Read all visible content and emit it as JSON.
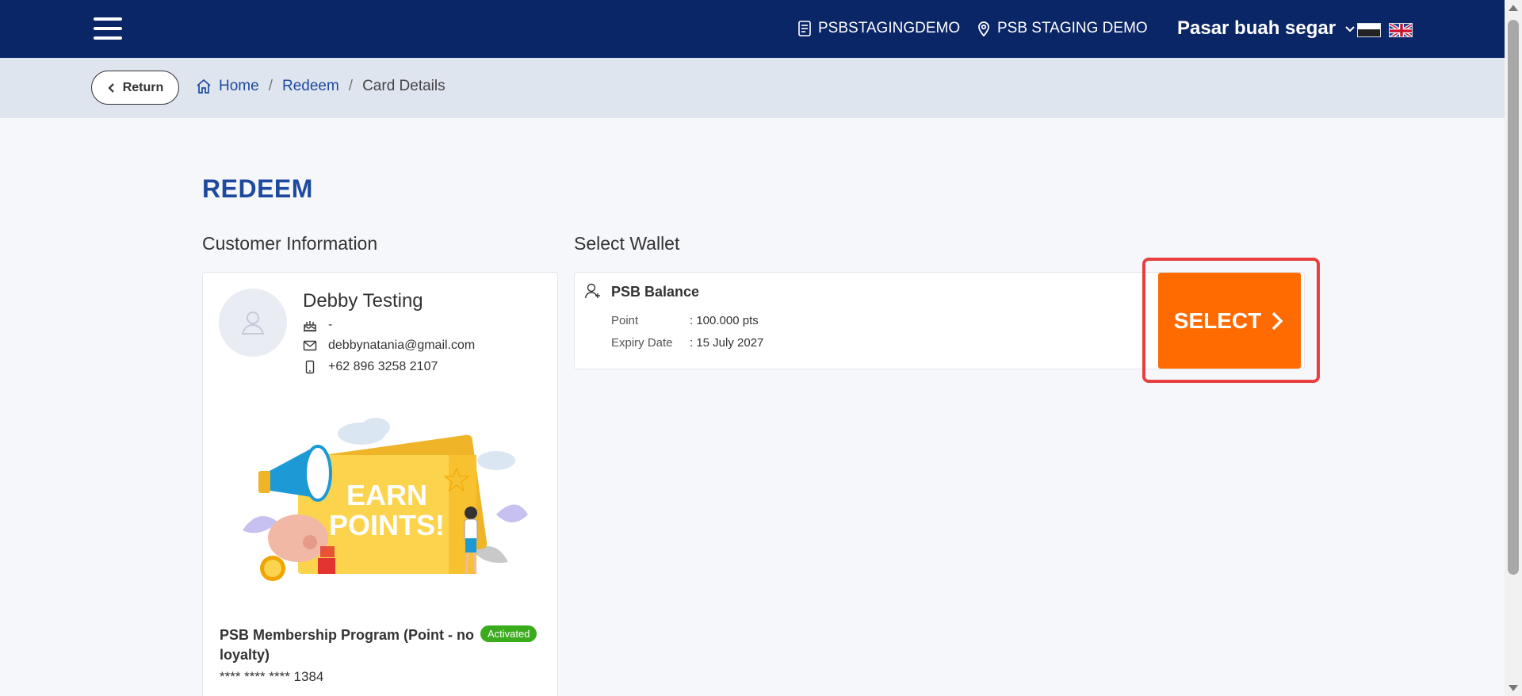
{
  "header": {
    "store_code": "PSBSTAGINGDEMO",
    "location": "PSB STAGING DEMO",
    "user": "Pasar buah segar",
    "icons": [
      "menu-icon",
      "receipt-icon",
      "location-pin-icon",
      "chevron-down-icon",
      "flag-id-icon",
      "flag-uk-icon"
    ]
  },
  "breadcrumb": {
    "return_label": "Return",
    "items": [
      "Home",
      "Redeem",
      "Card Details"
    ],
    "separator": "/"
  },
  "page": {
    "title": "REDEEM",
    "customer_section_title": "Customer Information",
    "wallet_section_title": "Select Wallet"
  },
  "customer": {
    "name": "Debby Testing",
    "birthday": "-",
    "email": "debbynatania@gmail.com",
    "phone": "+62 896 3258 2107",
    "image_text": {
      "line1": "EARN",
      "line2": "POINTS!"
    },
    "program_name": "PSB Membership Program (Point - no loyalty)",
    "status": "Activated",
    "card_number": "**** **** **** 1384"
  },
  "wallet": {
    "name": "PSB Balance",
    "point_label": "Point",
    "point_value": ": 100.000 pts",
    "expiry_label": "Expiry Date",
    "expiry_value": ": 15 July 2027",
    "select_label": "SELECT"
  },
  "colors": {
    "header_bg": "#0b2667",
    "accent_blue": "#1d4a9e",
    "select_orange": "#ff6b00",
    "highlight_red": "#e8403f",
    "badge_green": "#3bab1e"
  }
}
